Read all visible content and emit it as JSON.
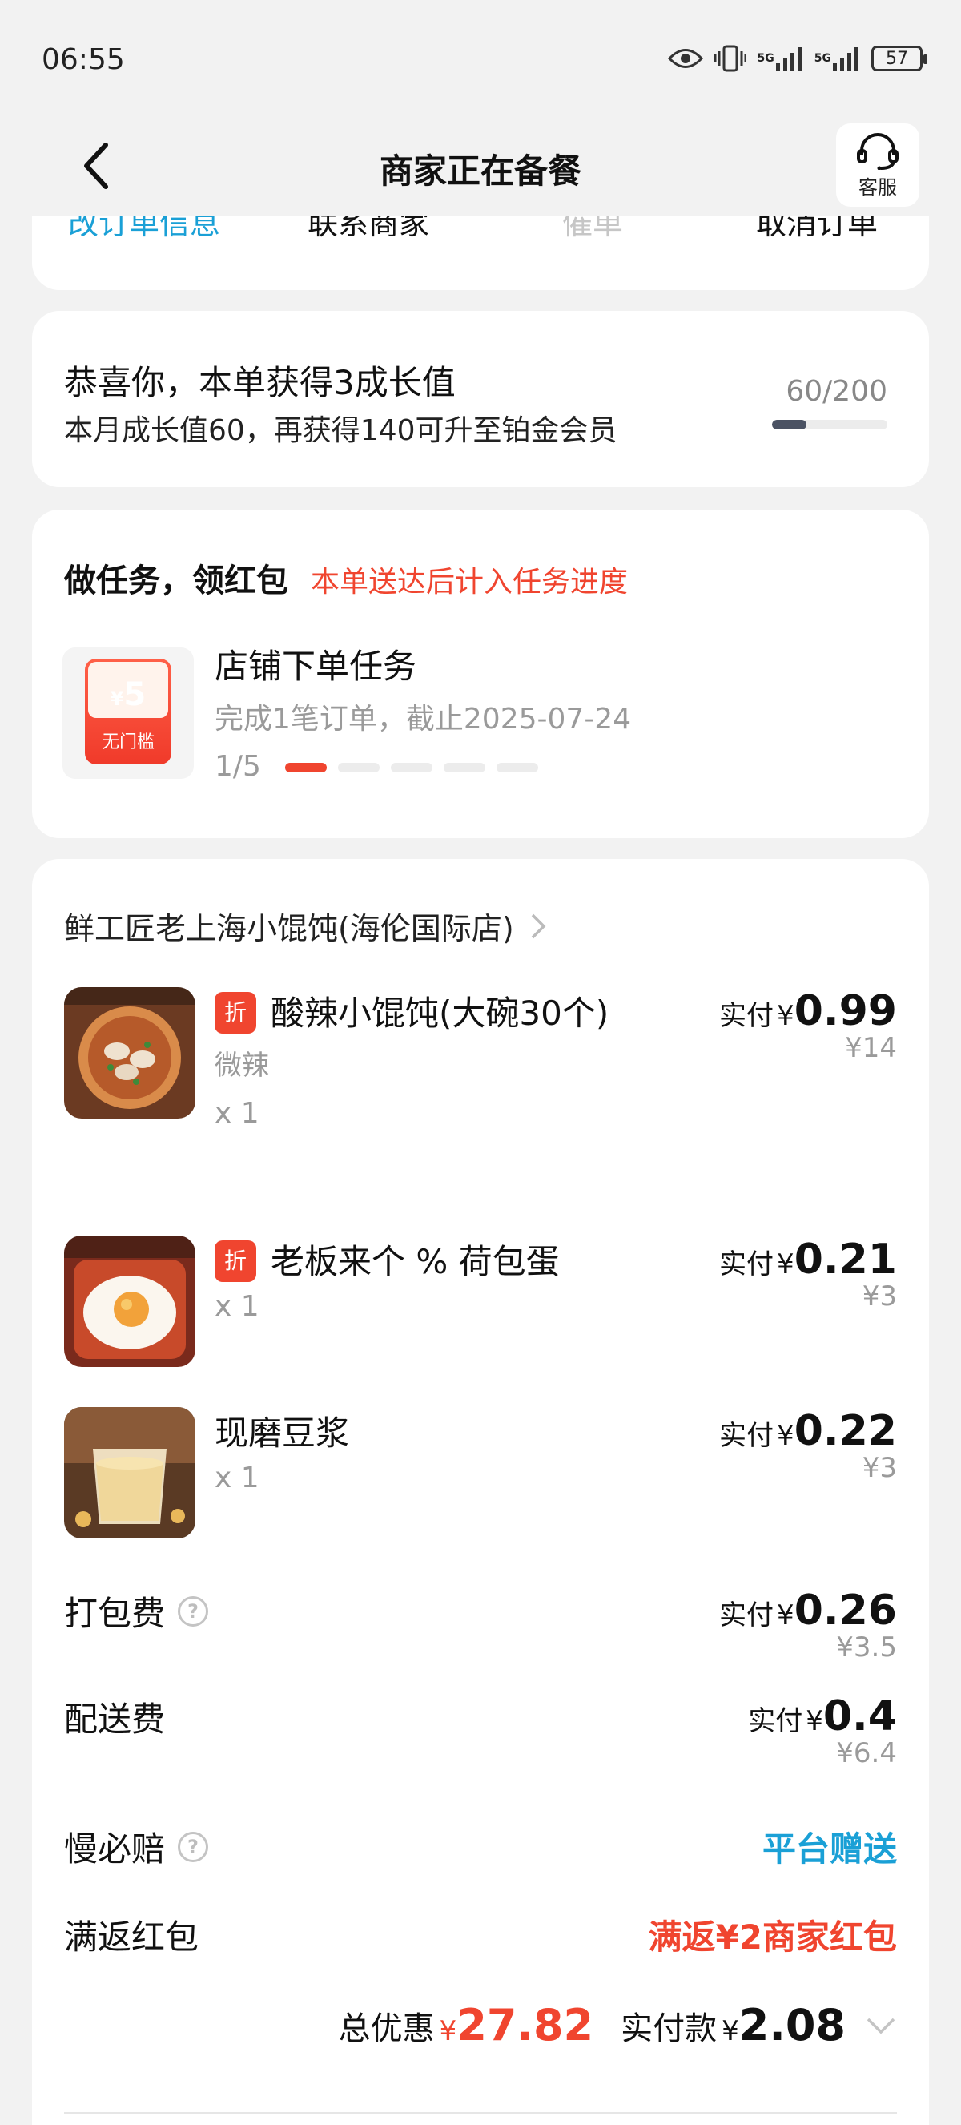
{
  "status_bar": {
    "time": "06:55",
    "network_1": "5G",
    "network_2": "5G",
    "battery": "57"
  },
  "header": {
    "title": "商家正在备餐",
    "customer_service_label": "客服"
  },
  "order_actions": [
    "改订单信息",
    "联系商家",
    "催单",
    "取消订单"
  ],
  "growth": {
    "title": "恭喜你，本单获得3成长值",
    "subtitle": "本月成长值60，再获得140可升至铂金会员",
    "progress_text": "60/200",
    "progress_fraction": 0.3
  },
  "task": {
    "title": "做任务，领红包",
    "note": "本单送达后计入任务进度",
    "coupon_currency": "¥",
    "coupon_amount": "5",
    "coupon_label": "无门槛",
    "name": "店铺下单任务",
    "description": "完成1笔订单，截止2025-07-24",
    "progress": "1/5",
    "progress_done": 1,
    "progress_total": 5
  },
  "order": {
    "store_name": "鲜工匠老上海小馄饨(海伦国际店)",
    "paid_prefix": "实付",
    "currency": "¥",
    "discount_tag": "折",
    "items": [
      {
        "name": "酸辣小馄饨(大碗30个)",
        "spec": "微辣",
        "qty": "x 1",
        "paid": "0.99",
        "original": "¥14",
        "discount": true
      },
      {
        "name": "老板来个 % 荷包蛋",
        "spec": "",
        "qty": "x 1",
        "paid": "0.21",
        "original": "¥3",
        "discount": true
      },
      {
        "name": "现磨豆浆",
        "spec": "",
        "qty": "x 1",
        "paid": "0.22",
        "original": "¥3",
        "discount": false
      }
    ],
    "packing_fee": {
      "label": "打包费",
      "paid": "0.26",
      "original": "¥3.5"
    },
    "delivery_fee": {
      "label": "配送费",
      "paid": "0.4",
      "original": "¥6.4"
    },
    "late_guarantee": {
      "label": "慢必赔",
      "value": "平台赠送"
    },
    "cashback": {
      "label": "满返红包",
      "value": "满返¥2商家红包"
    },
    "total": {
      "discount_label": "总优惠",
      "discount_amount": "27.82",
      "paid_label": "实付款",
      "paid_amount": "2.08"
    }
  },
  "colors": {
    "accent_blue": "#1aa0d6",
    "accent_red": "#f0452f",
    "background": "#f2f2f2"
  }
}
